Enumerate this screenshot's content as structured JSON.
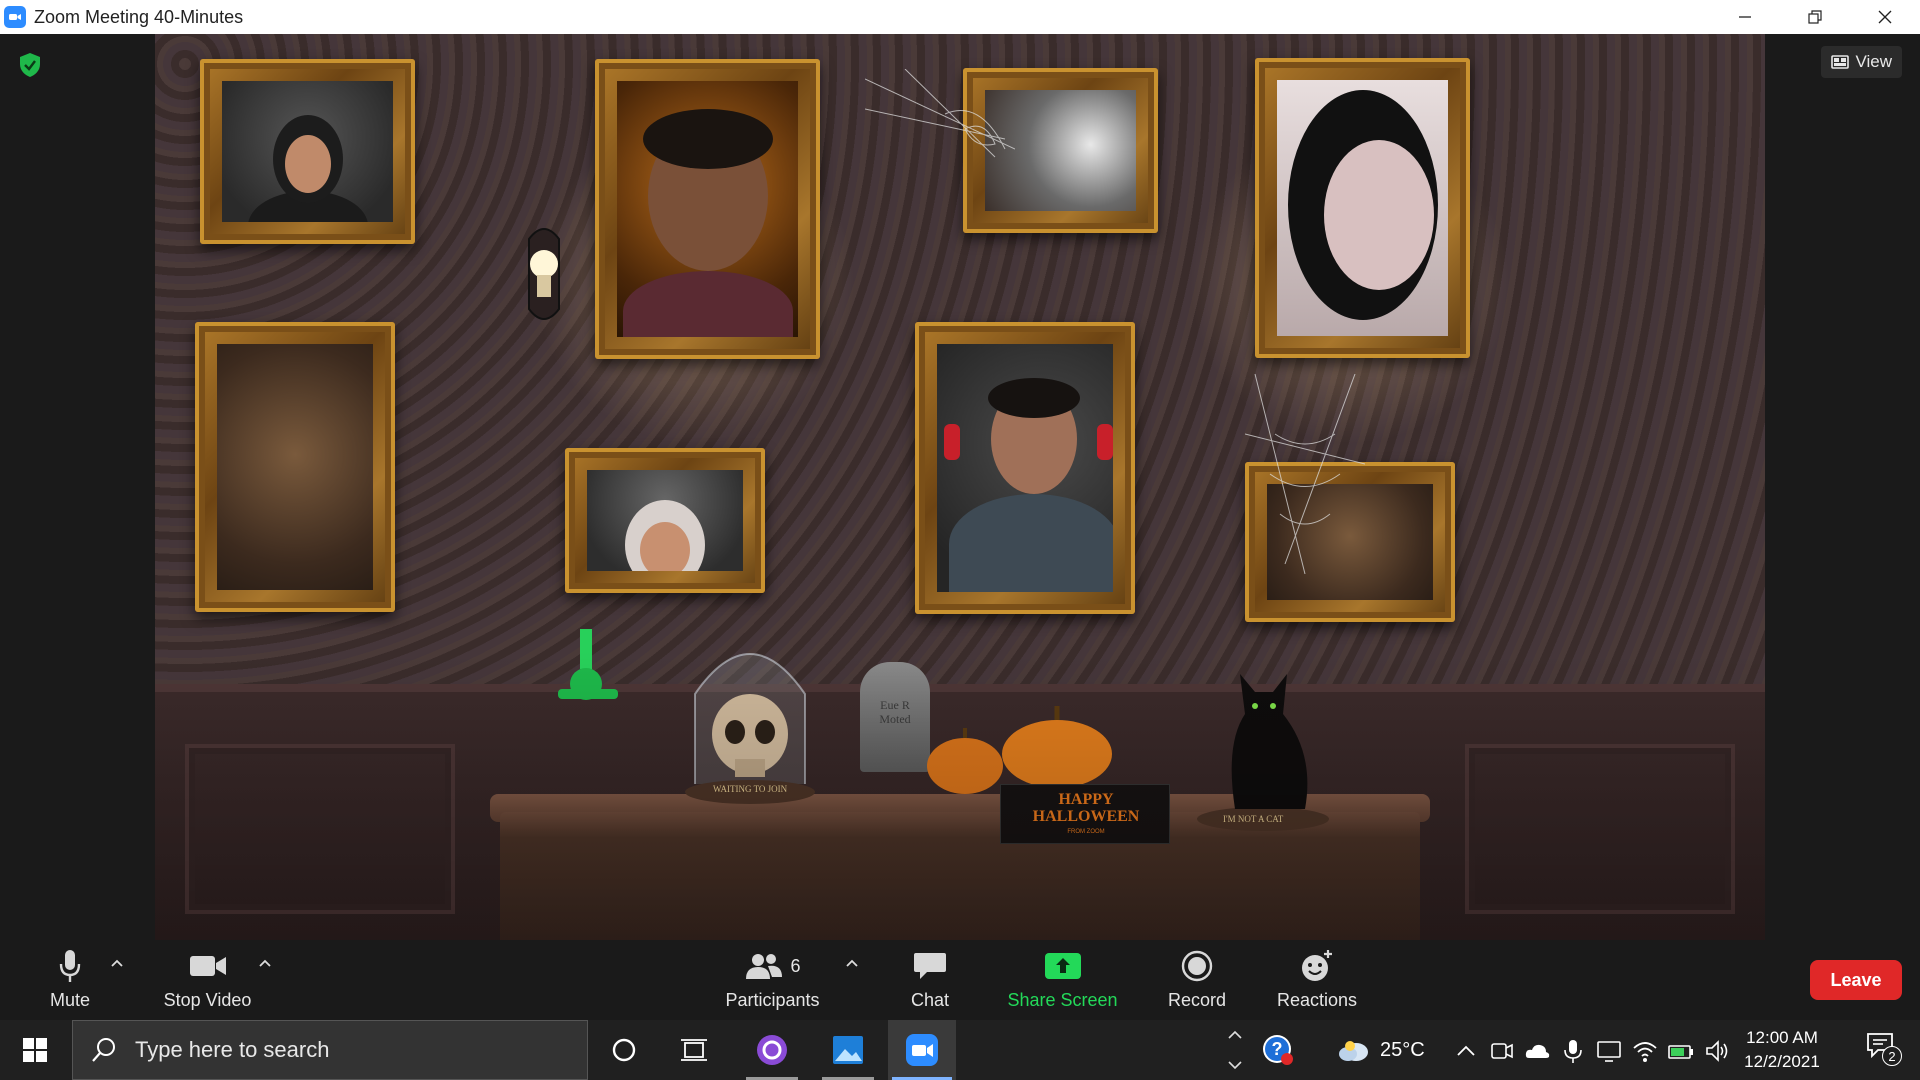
{
  "window": {
    "title": "Zoom Meeting 40-Minutes"
  },
  "meeting": {
    "view_label": "View",
    "background_props": {
      "tombstone_text": "Eue R Moted",
      "dome_plaque": "WAITING TO JOIN",
      "cat_plaque": "I'M NOT A CAT",
      "sign_line1": "HAPPY",
      "sign_line2": "HALLOWEEN",
      "sign_line3": "FROM ZOOM"
    }
  },
  "toolbar": {
    "mute": "Mute",
    "stop_video": "Stop Video",
    "participants": "Participants",
    "participant_count": "6",
    "chat": "Chat",
    "share_screen": "Share Screen",
    "record": "Record",
    "reactions": "Reactions",
    "leave": "Leave"
  },
  "taskbar": {
    "search_placeholder": "Type here to search",
    "weather": "25°C",
    "time": "12:00 AM",
    "date": "12/2/2021",
    "notification_count": "2"
  },
  "colors": {
    "zoom_blue": "#2D8CFF",
    "share_green": "#23D959",
    "leave_red": "#E02828",
    "toolbar_bg": "#1A1A1A",
    "taskbar_bg": "#202020"
  }
}
